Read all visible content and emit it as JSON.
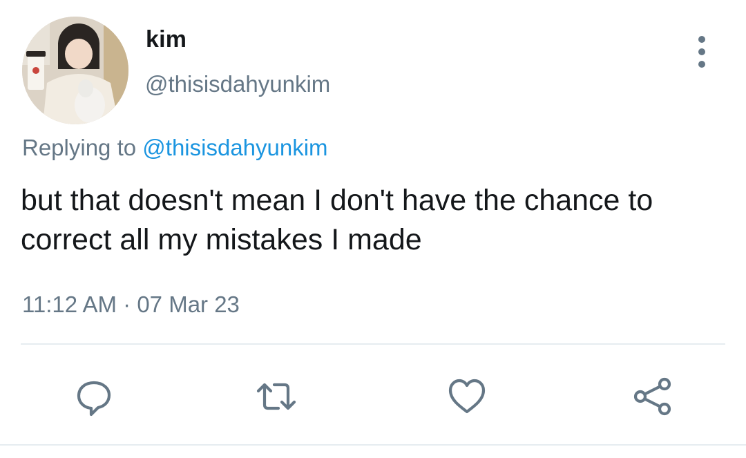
{
  "tweet": {
    "display_name": "kim",
    "handle": "@thisisdahyunkim",
    "replying_prefix": "Replying to",
    "replying_to": "@thisisdahyunkim",
    "text": "but that doesn't mean I don't have the chance to correct all my mistakes I made",
    "time": "11:12 AM",
    "separator": "·",
    "date": "07 Mar 23"
  },
  "icons": {
    "more": "more-vertical-icon",
    "reply": "reply-bubble-icon",
    "retweet": "retweet-icon",
    "like": "heart-icon",
    "share": "share-icon"
  },
  "colors": {
    "text_primary": "#14171a",
    "text_secondary": "#657786",
    "link": "#1b95e0",
    "divider": "#e6ecf0"
  }
}
